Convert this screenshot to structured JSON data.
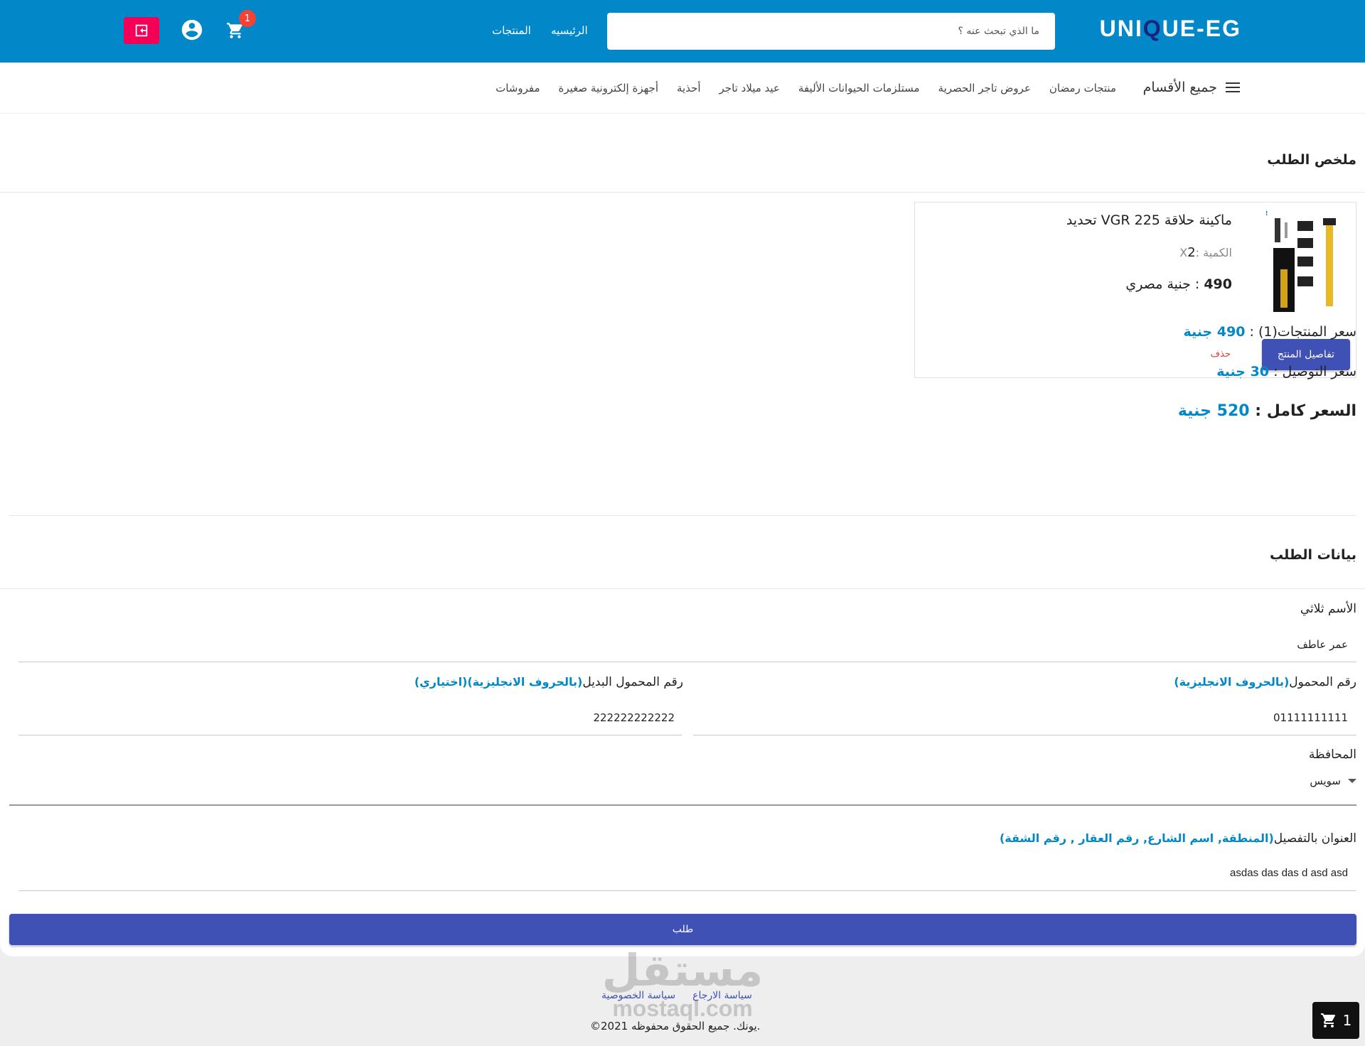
{
  "header": {
    "logo_prefix": "UNI",
    "logo_accent": "Q",
    "logo_suffix": "UE-EG",
    "search_placeholder": "ما الذي تبحث عنه ؟",
    "nav": {
      "home": "الرئيسيه",
      "products": "المنتجات"
    },
    "cart_count": "1",
    "icons": [
      "logout-icon",
      "account-circle-icon",
      "shopping-cart-icon"
    ],
    "colors": {
      "primary": "#0288c9",
      "logout_button": "#f50057",
      "badge": "#f44336"
    }
  },
  "categories": {
    "all_label": "جميع الأقسام",
    "items": [
      "منتجات رمضان",
      "عروض تاجر الحصرية",
      "مستلزمات الحيوانات الأليفة",
      "عيد ميلاد تاجر",
      "أحذية",
      "أجهزة إلكترونية صغيرة",
      "مفروشات"
    ]
  },
  "summary": {
    "title": "ملخص الطلب",
    "product": {
      "name": "ماكينة حلاقة VGR 225 تحديد",
      "qty_label": "الكمية :X",
      "qty_value": "2",
      "price_value": "490",
      "price_label": ": جنية مصري",
      "details_button": "تفاصيل المنتج",
      "delete_label": "حذف"
    },
    "products_price_label": "سعر المنتجات(1) : ",
    "products_price_value": "490 جنية",
    "delivery_label": "سعر التوصيل : ",
    "delivery_value": "30 جنية",
    "total_label": "السعر كامل : ",
    "total_value": "520 جنية"
  },
  "order_form": {
    "title": "بيانات الطلب",
    "name_label": "الأسم ثلاثي",
    "name_value": "عمر عاطف",
    "phone_label": "رقم المحمول",
    "phone_hint": "(بالحروف الانجليزية)",
    "phone_value": "01111111111",
    "alt_phone_label": "رقم المحمول البديل",
    "alt_phone_hint": "(بالحروف الانجليزية)(اختياري)",
    "alt_phone_value": "222222222222",
    "governorate_label": "المحافظة",
    "governorate_value": "سويس",
    "address_label": "العنوان بالتفصيل",
    "address_hint": "(المنطقة, اسم الشارع, رقم العقار , رقم الشقة)",
    "address_value": "asdas das das d asd asd",
    "submit_label": "طلب",
    "button_color": "#3f51b5"
  },
  "footer": {
    "return_policy": "سياسة الارجاع",
    "privacy_policy": "سياسة الخصوصية",
    "copyright": ".يونك. جميع الحقوق محفوظه 2021©",
    "watermark_ar": "مستقل",
    "watermark_en": "mostaql.com",
    "float_cart_count": "1"
  }
}
